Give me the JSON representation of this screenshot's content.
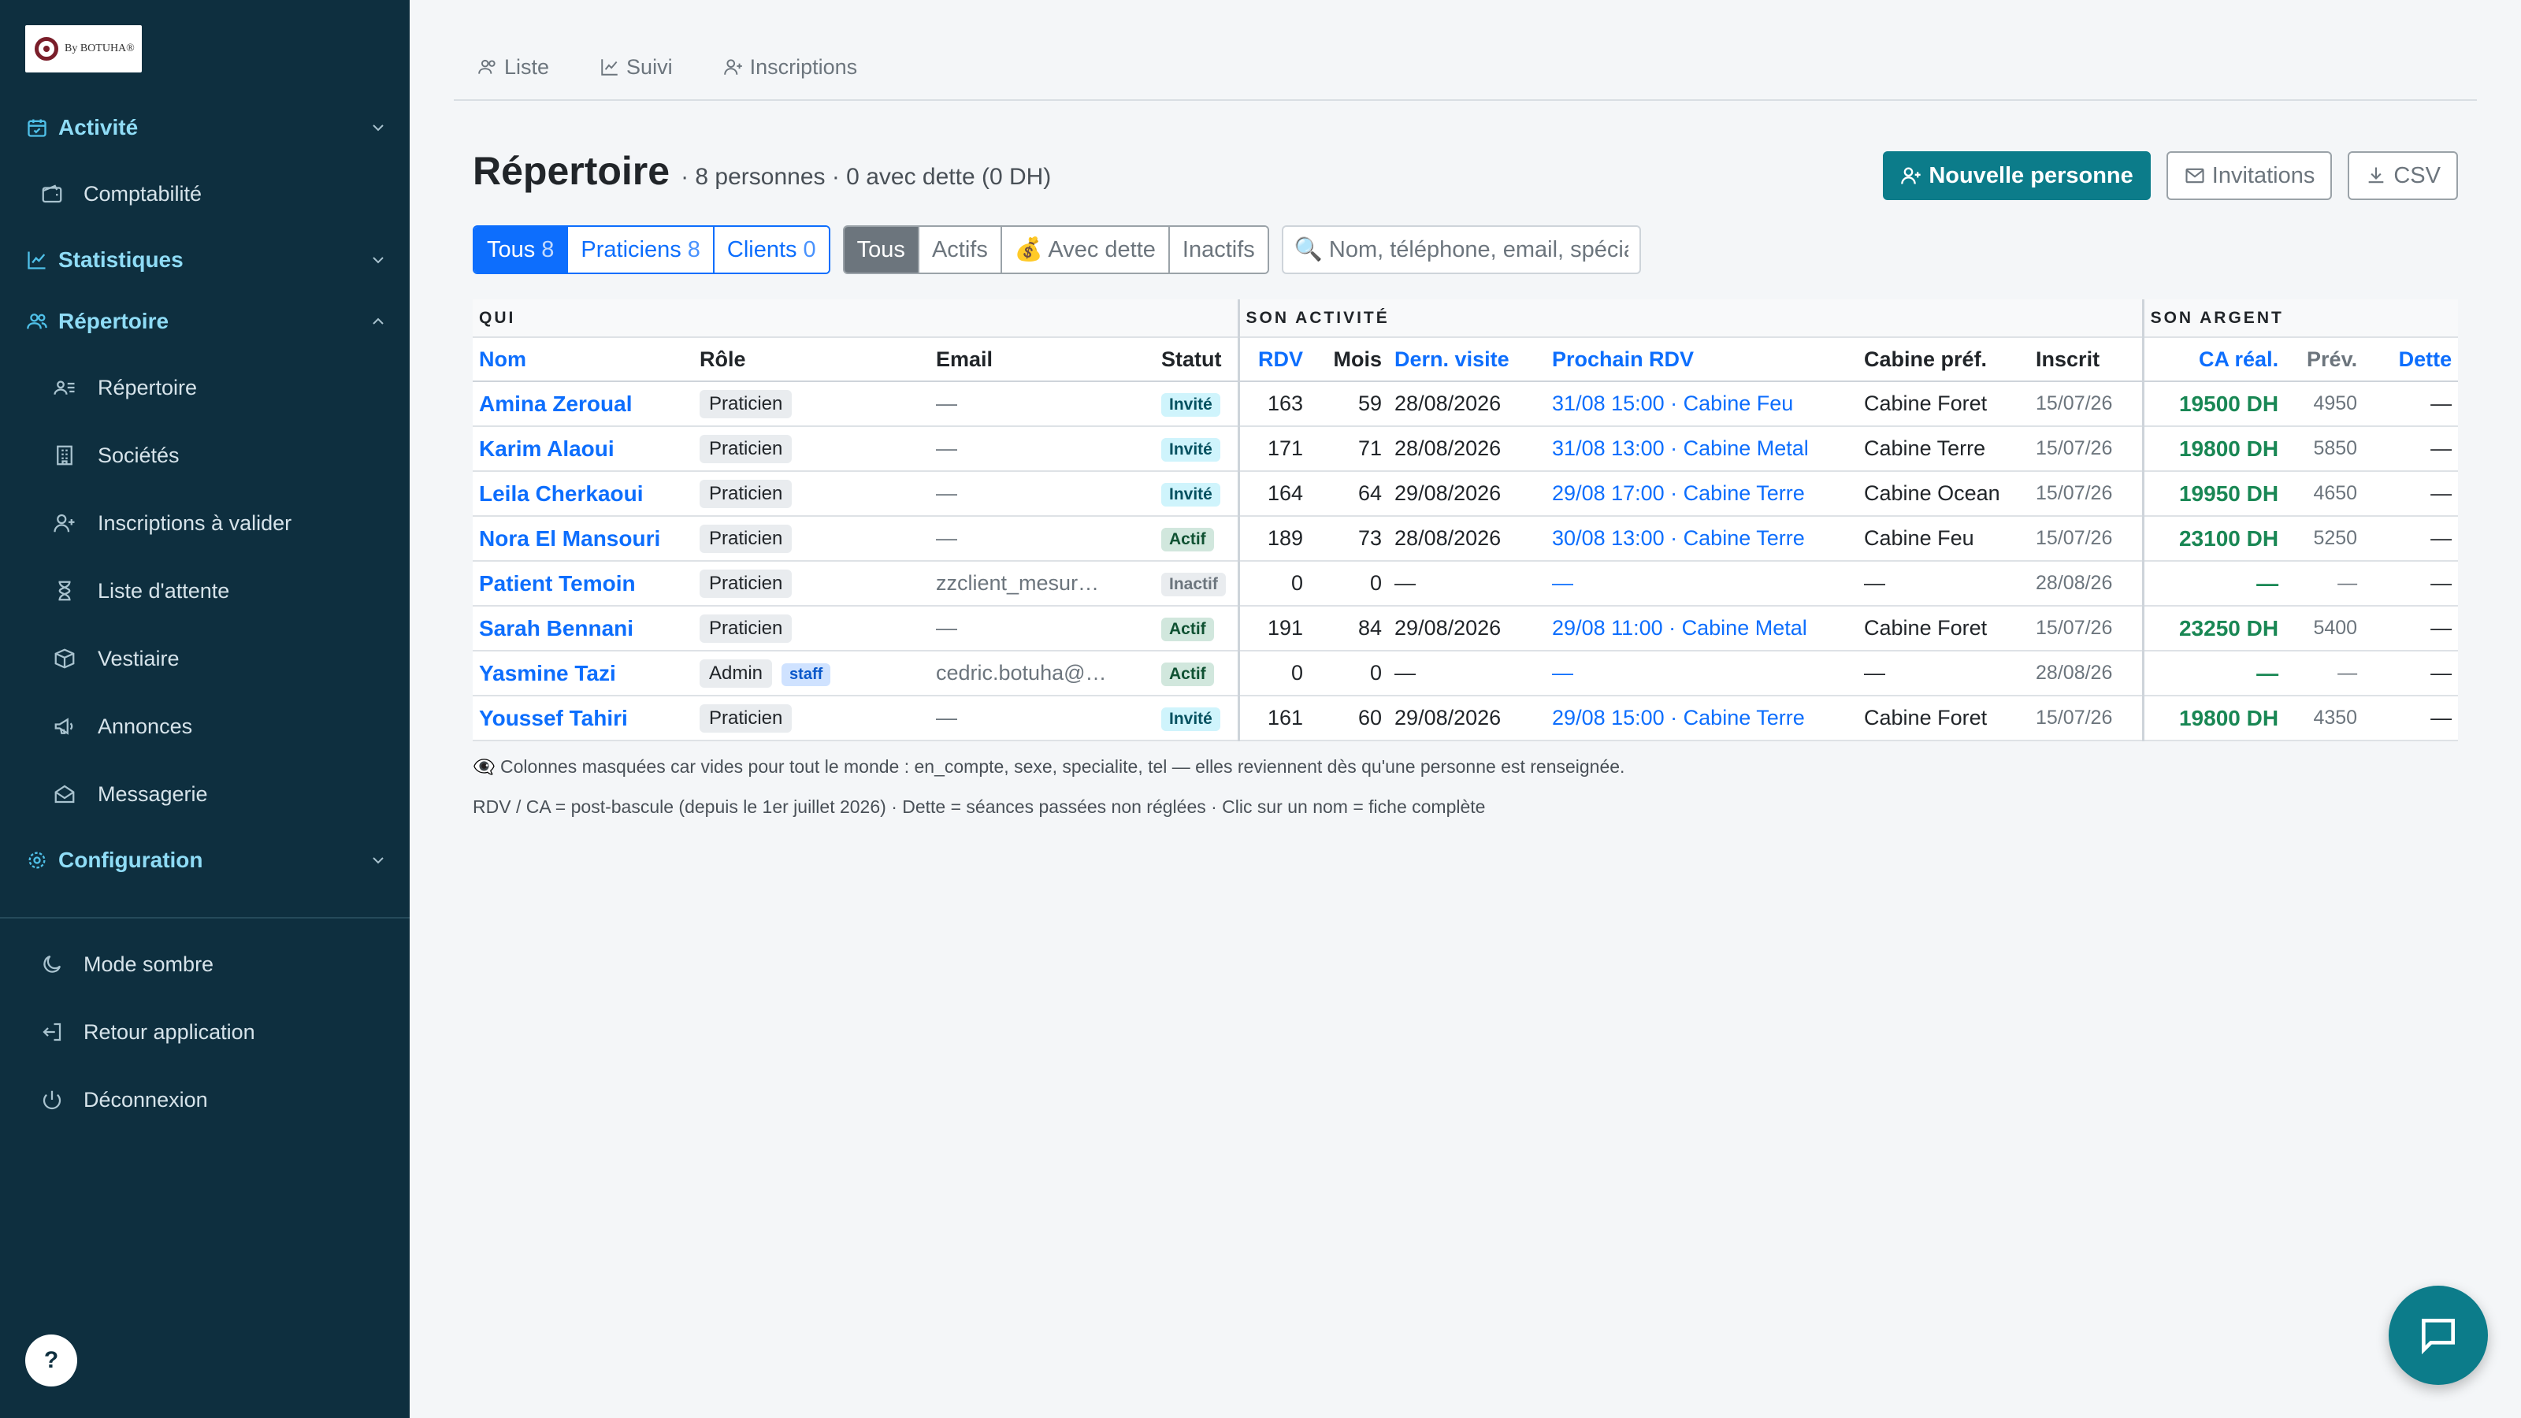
{
  "brand": {
    "logo_text": "By BOTUHA®"
  },
  "sidebar": {
    "sections": [
      {
        "label": "Activité",
        "expanded": false
      },
      {
        "label": "Statistiques",
        "expanded": false
      },
      {
        "label": "Répertoire",
        "expanded": true
      },
      {
        "label": "Configuration",
        "expanded": false
      }
    ],
    "items": {
      "comptabilite": "Comptabilité",
      "repertoire": "Répertoire",
      "societes": "Sociétés",
      "inscriptions": "Inscriptions à valider",
      "attente": "Liste d'attente",
      "vestiaire": "Vestiaire",
      "annonces": "Annonces",
      "messagerie": "Messagerie"
    },
    "footer": {
      "mode_sombre": "Mode sombre",
      "retour": "Retour application",
      "deconnexion": "Déconnexion"
    },
    "help": "?"
  },
  "tabs": [
    "Liste",
    "Suivi",
    "Inscriptions"
  ],
  "header": {
    "title": "Répertoire",
    "subtitle": "· 8 personnes · 0 avec dette (0 DH)"
  },
  "actions": {
    "new_person": "Nouvelle personne",
    "invitations": "Invitations",
    "csv": "CSV"
  },
  "filters": {
    "type": [
      {
        "label": "Tous",
        "count": "8",
        "active": true
      },
      {
        "label": "Praticiens",
        "count": "8",
        "active": false
      },
      {
        "label": "Clients",
        "count": "0",
        "active": false
      }
    ],
    "state": [
      {
        "label": "Tous",
        "active": true
      },
      {
        "label": "Actifs",
        "active": false
      },
      {
        "label": "💰 Avec dette",
        "active": false
      },
      {
        "label": "Inactifs",
        "active": false
      }
    ],
    "search_placeholder": "Nom, téléphone, email, spécialité…"
  },
  "table": {
    "groups": [
      "QUI",
      "SON ACTIVITÉ",
      "SON ARGENT"
    ],
    "columns": [
      "Nom",
      "Rôle",
      "Email",
      "Statut",
      "RDV",
      "Mois",
      "Dern. visite",
      "Prochain RDV",
      "Cabine préf.",
      "Inscrit",
      "CA réal.",
      "Prév.",
      "Dette"
    ],
    "rows": [
      {
        "nom": "Amina Zeroual",
        "role": "Praticien",
        "staff": "",
        "email": "—",
        "statut": "Invité",
        "rdv": "163",
        "mois": "59",
        "dern": "28/08/2026",
        "prochain": "31/08 15:00 · Cabine Feu",
        "cabine": "Cabine Foret",
        "inscrit": "15/07/26",
        "ca": "19500 DH",
        "prev": "4950",
        "dette": "—"
      },
      {
        "nom": "Karim Alaoui",
        "role": "Praticien",
        "staff": "",
        "email": "—",
        "statut": "Invité",
        "rdv": "171",
        "mois": "71",
        "dern": "28/08/2026",
        "prochain": "31/08 13:00 · Cabine Metal",
        "cabine": "Cabine Terre",
        "inscrit": "15/07/26",
        "ca": "19800 DH",
        "prev": "5850",
        "dette": "—"
      },
      {
        "nom": "Leila Cherkaoui",
        "role": "Praticien",
        "staff": "",
        "email": "—",
        "statut": "Invité",
        "rdv": "164",
        "mois": "64",
        "dern": "29/08/2026",
        "prochain": "29/08 17:00 · Cabine Terre",
        "cabine": "Cabine Ocean",
        "inscrit": "15/07/26",
        "ca": "19950 DH",
        "prev": "4650",
        "dette": "—"
      },
      {
        "nom": "Nora El Mansouri",
        "role": "Praticien",
        "staff": "",
        "email": "—",
        "statut": "Actif",
        "rdv": "189",
        "mois": "73",
        "dern": "28/08/2026",
        "prochain": "30/08 13:00 · Cabine Terre",
        "cabine": "Cabine Feu",
        "inscrit": "15/07/26",
        "ca": "23100 DH",
        "prev": "5250",
        "dette": "—"
      },
      {
        "nom": "Patient Temoin",
        "role": "Praticien",
        "staff": "",
        "email": "zzclient_mesur…",
        "statut": "Inactif",
        "rdv": "0",
        "mois": "0",
        "dern": "—",
        "prochain": "—",
        "cabine": "—",
        "inscrit": "28/08/26",
        "ca": "—",
        "prev": "—",
        "dette": "—"
      },
      {
        "nom": "Sarah Bennani",
        "role": "Praticien",
        "staff": "",
        "email": "—",
        "statut": "Actif",
        "rdv": "191",
        "mois": "84",
        "dern": "29/08/2026",
        "prochain": "29/08 11:00 · Cabine Metal",
        "cabine": "Cabine Foret",
        "inscrit": "15/07/26",
        "ca": "23250 DH",
        "prev": "5400",
        "dette": "—"
      },
      {
        "nom": "Yasmine Tazi",
        "role": "Admin",
        "staff": "staff",
        "email": "cedric.botuha@…",
        "statut": "Actif",
        "rdv": "0",
        "mois": "0",
        "dern": "—",
        "prochain": "—",
        "cabine": "—",
        "inscrit": "28/08/26",
        "ca": "—",
        "prev": "—",
        "dette": "—"
      },
      {
        "nom": "Youssef Tahiri",
        "role": "Praticien",
        "staff": "",
        "email": "—",
        "statut": "Invité",
        "rdv": "161",
        "mois": "60",
        "dern": "29/08/2026",
        "prochain": "29/08 15:00 · Cabine Terre",
        "cabine": "Cabine Foret",
        "inscrit": "15/07/26",
        "ca": "19800 DH",
        "prev": "4350",
        "dette": "—"
      }
    ]
  },
  "notes": {
    "hidden_cols": "👁‍🗨 Colonnes masquées car vides pour tout le monde : en_compte, sexe, specialite, tel — elles reviennent dès qu'une personne est renseignée.",
    "legend": "RDV / CA = post-bascule (depuis le 1er juillet 2026) · Dette = séances passées non réglées · Clic sur un nom = fiche complète"
  },
  "colors": {
    "sidebar_bg": "#0e2f3f",
    "primary": "#0c7c8a",
    "link": "#0d6efd",
    "money": "#198754"
  }
}
